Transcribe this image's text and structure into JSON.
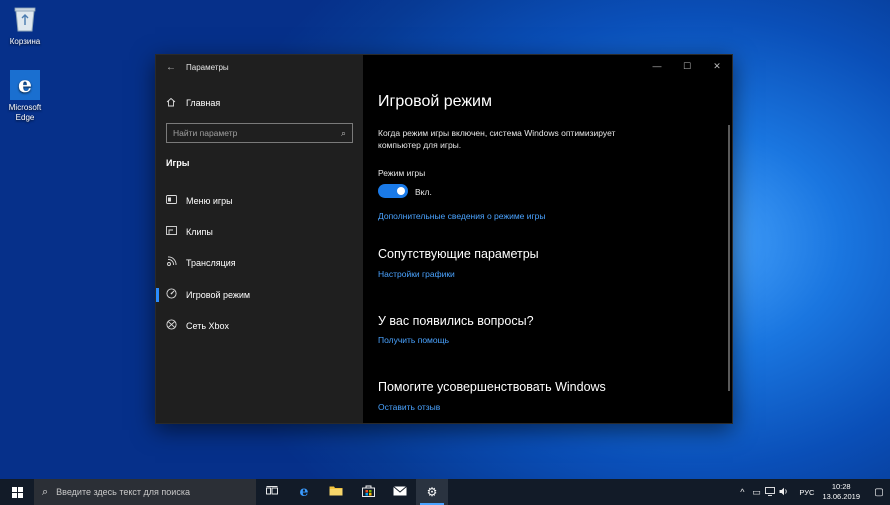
{
  "desktop": {
    "icons": [
      {
        "label": "Корзина",
        "icon": "recycle-bin-icon"
      },
      {
        "label": "Microsoft Edge",
        "icon": "edge-icon"
      }
    ]
  },
  "window": {
    "title": "Параметры",
    "sidebar": {
      "home_label": "Главная",
      "search_placeholder": "Найти параметр",
      "section_label": "Игры",
      "items": [
        {
          "label": "Меню игры",
          "icon": "xbox-gamebar-icon"
        },
        {
          "label": "Клипы",
          "icon": "clips-icon"
        },
        {
          "label": "Трансляция",
          "icon": "broadcast-icon"
        },
        {
          "label": "Игровой режим",
          "icon": "game-mode-icon",
          "active": true
        },
        {
          "label": "Сеть Xbox",
          "icon": "xbox-icon"
        }
      ]
    },
    "content": {
      "title": "Игровой режим",
      "description": "Когда режим игры включен, система Windows оптимизирует компьютер для игры.",
      "toggle_label": "Режим игры",
      "toggle_state": "Вкл.",
      "toggle_on": true,
      "more_info_link": "Дополнительные сведения о режиме игры",
      "related_heading": "Сопутствующие параметры",
      "related_link": "Настройки графики",
      "questions_heading": "У вас появились вопросы?",
      "questions_link": "Получить помощь",
      "improve_heading": "Помогите усовершенствовать Windows",
      "improve_link": "Оставить отзыв"
    }
  },
  "taskbar": {
    "search_placeholder": "Введите здесь текст для поиска",
    "language": "РУС",
    "time": "10:28",
    "date": "13.06.2019"
  },
  "colors": {
    "accent": "#1a7ae8",
    "link": "#4aa3ff",
    "sidebar_bg": "#1f1f1f",
    "content_bg": "#000000",
    "taskbar_bg": "#121b28"
  }
}
